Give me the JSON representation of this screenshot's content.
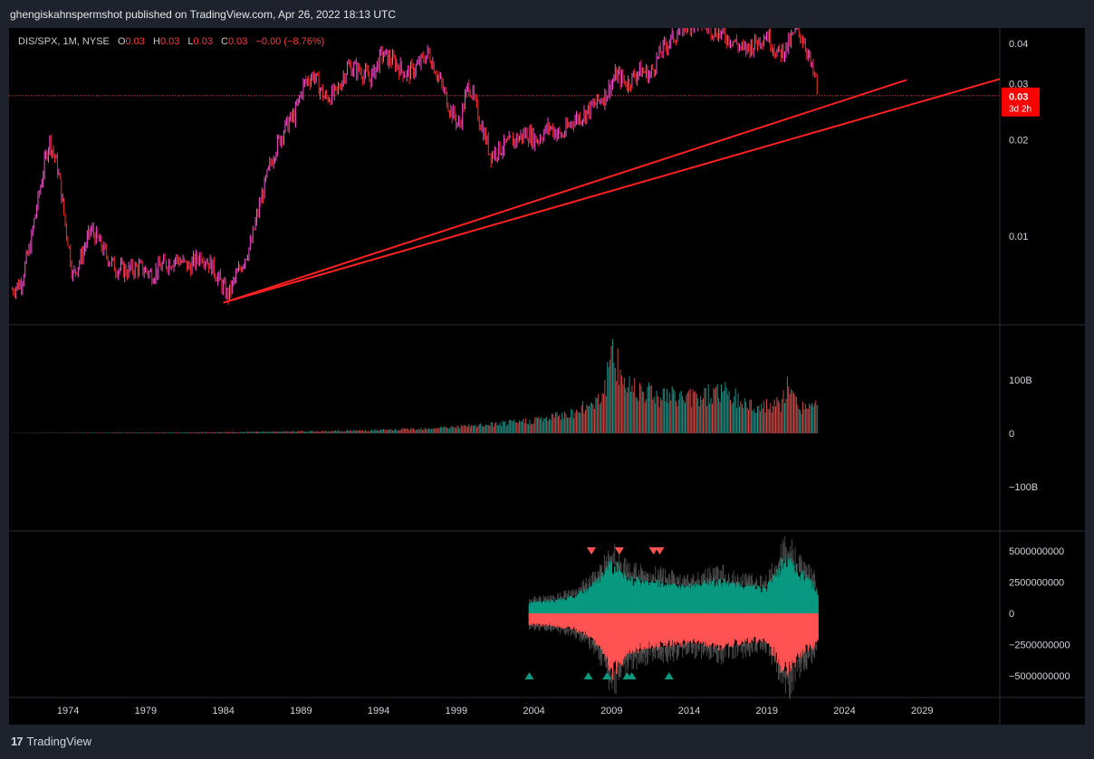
{
  "header": {
    "publisher_line": "ghengiskahnspermshot published on TradingView.com, Apr 26, 2022 18:13 UTC"
  },
  "legend": {
    "symbol": "DIS/SPX, 1M, NYSE",
    "o_label": "O",
    "o_value": "0.03",
    "h_label": "H",
    "h_value": "0.03",
    "l_label": "L",
    "l_value": "0.03",
    "c_label": "C",
    "c_value": "0.03",
    "change": "−0.00 (−8.76%)"
  },
  "price_badge": {
    "value": "0.03",
    "countdown": "3d 2h"
  },
  "footer": {
    "brand": "TradingView",
    "logo_glyph": "17"
  },
  "colors": {
    "up": "#ff4fd8",
    "down": "#ff2a2a",
    "trend": "#ff2020",
    "vol_up": "#26a69a",
    "vol_down": "#ef5350",
    "teal": "#089981",
    "salmon": "#ff5252"
  },
  "chart_data": [
    {
      "type": "line",
      "pane": "price",
      "title": "",
      "scale": "log",
      "y_ticks": [
        "0.04",
        "0.03",
        "0.02",
        "0.01"
      ],
      "y_tick_values": [
        0.04,
        0.03,
        0.02,
        0.01
      ],
      "ylim": [
        0.0055,
        0.043
      ],
      "x_ticks": [
        "1974",
        "1979",
        "1984",
        "1989",
        "1994",
        "1999",
        "2004",
        "2009",
        "2014",
        "2019",
        "2024",
        "2029"
      ],
      "x_tick_values": [
        1974,
        1979,
        1984,
        1989,
        1994,
        1999,
        2004,
        2009,
        2014,
        2019,
        2024,
        2029
      ],
      "xlim": [
        1970.2,
        2034.0
      ],
      "last_price": 0.0275,
      "series": [
        {
          "x": [
            1970.4,
            1971.0,
            1971.6,
            1972.2,
            1972.8,
            1973.3,
            1973.8,
            1974.3,
            1974.8,
            1975.5,
            1976.3,
            1977.0,
            1977.8,
            1978.6,
            1979.4,
            1980.2,
            1981.0,
            1981.8,
            1982.6,
            1983.3,
            1983.8,
            1984.3,
            1985.0,
            1985.8,
            1986.6,
            1987.3,
            1988.0,
            1988.6,
            1989.2,
            1989.8,
            1990.5,
            1991.3,
            1992.0,
            1992.8,
            1993.5,
            1994.2,
            1995.0,
            1995.8,
            1996.5,
            1997.2,
            1998.0,
            1998.6,
            1999.2,
            1999.8,
            2000.5,
            2001.2,
            2002.0,
            2002.8,
            2003.5,
            2004.2,
            2005.0,
            2005.8,
            2006.5,
            2007.2,
            2008.0,
            2008.7,
            2009.3,
            2010.0,
            2010.8,
            2011.5,
            2012.2,
            2013.0,
            2013.8,
            2014.5,
            2015.3,
            2016.0,
            2016.8,
            2017.5,
            2018.2,
            2019.0,
            2019.7,
            2020.3,
            2020.9,
            2021.4,
            2021.9,
            2022.2,
            2022.3
          ],
          "y": [
            0.0068,
            0.0072,
            0.0095,
            0.014,
            0.02,
            0.0165,
            0.011,
            0.0075,
            0.0085,
            0.0105,
            0.009,
            0.008,
            0.0078,
            0.008,
            0.0076,
            0.0082,
            0.0085,
            0.008,
            0.0088,
            0.008,
            0.0072,
            0.0065,
            0.0078,
            0.0095,
            0.014,
            0.0185,
            0.022,
            0.024,
            0.03,
            0.032,
            0.027,
            0.028,
            0.034,
            0.033,
            0.031,
            0.037,
            0.035,
            0.032,
            0.034,
            0.0375,
            0.03,
            0.025,
            0.022,
            0.03,
            0.023,
            0.018,
            0.019,
            0.02,
            0.021,
            0.02,
            0.022,
            0.0205,
            0.023,
            0.024,
            0.026,
            0.028,
            0.032,
            0.03,
            0.033,
            0.032,
            0.038,
            0.042,
            0.046,
            0.047,
            0.045,
            0.043,
            0.041,
            0.038,
            0.04,
            0.043,
            0.037,
            0.039,
            0.044,
            0.041,
            0.033,
            0.03,
            0.0275
          ]
        }
      ],
      "trendlines": [
        {
          "from": [
            1984.0,
            0.0062
          ],
          "to": [
            2028.0,
            0.0308
          ]
        },
        {
          "from": [
            1984.0,
            0.0062
          ],
          "to": [
            2034.0,
            0.031
          ]
        }
      ]
    },
    {
      "type": "bar",
      "pane": "volume",
      "title": "",
      "y_ticks": [
        "100B",
        "0",
        "−100B"
      ],
      "y_tick_values": [
        100,
        0,
        -100
      ],
      "ylim": [
        -170,
        170
      ],
      "units": "B",
      "x": [
        1970.4,
        1975.0,
        1980.0,
        1985.0,
        1990.0,
        1995.0,
        2000.0,
        2003.0,
        2005.0,
        2007.0,
        2008.5,
        2009.0,
        2010.0,
        2011.0,
        2012.0,
        2013.0,
        2014.0,
        2015.0,
        2016.0,
        2017.0,
        2018.0,
        2019.0,
        2020.0,
        2020.3,
        2021.0,
        2022.0,
        2022.3
      ],
      "values": [
        0.5,
        1.0,
        1.5,
        2.5,
        4.0,
        7.0,
        14.0,
        22.0,
        30.0,
        45.0,
        80.0,
        150.0,
        95.0,
        90.0,
        75.0,
        72.0,
        70.0,
        75.0,
        85.0,
        68.0,
        55.0,
        52.0,
        58.0,
        90.0,
        55.0,
        50.0,
        58.0
      ]
    },
    {
      "type": "bar",
      "pane": "oscillator",
      "title": "",
      "y_ticks": [
        "5000000000",
        "2500000000",
        "0",
        "−2500000000",
        "−5000000000"
      ],
      "y_tick_values": [
        5000000000,
        2500000000,
        0,
        -2500000000,
        -5000000000
      ],
      "ylim": [
        -6700000000,
        6500000000
      ],
      "x": [
        2003.7,
        2005.0,
        2006.5,
        2007.5,
        2008.5,
        2009.0,
        2010.0,
        2011.0,
        2012.0,
        2013.0,
        2014.0,
        2015.0,
        2016.0,
        2017.0,
        2018.0,
        2019.0,
        2020.0,
        2020.4,
        2021.0,
        2022.0,
        2022.3
      ],
      "series": [
        {
          "name": "",
          "values": [
            1000000000,
            1100000000,
            1500000000,
            2200000000,
            3500000000,
            4600000000,
            3200000000,
            2900000000,
            2800000000,
            2600000000,
            2400000000,
            2700000000,
            3000000000,
            2600000000,
            2400000000,
            2300000000,
            4500000000,
            4900000000,
            3800000000,
            2700000000,
            1600000000
          ]
        },
        {
          "name": "",
          "values": [
            -1000000000,
            -1100000000,
            -1400000000,
            -2000000000,
            -3400000000,
            -5500000000,
            -3600000000,
            -3200000000,
            -3000000000,
            -2900000000,
            -2600000000,
            -2800000000,
            -3100000000,
            -2800000000,
            -2600000000,
            -2500000000,
            -5000000000,
            -5300000000,
            -4000000000,
            -3000000000,
            -2500000000
          ]
        }
      ],
      "sell_markers": [
        2007.7,
        2009.5,
        2011.7,
        2012.1
      ],
      "buy_markers": [
        2003.7,
        2007.5,
        2008.7,
        2010.0,
        2010.3,
        2012.7
      ]
    }
  ]
}
